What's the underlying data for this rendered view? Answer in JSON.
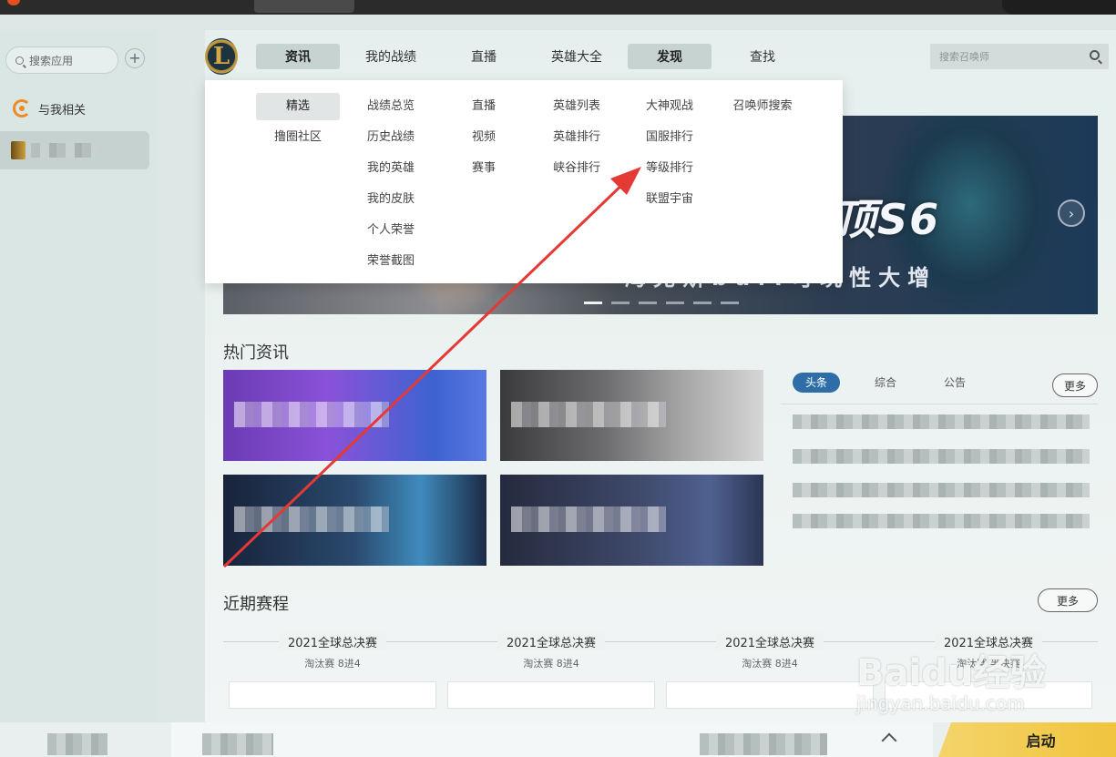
{
  "sidebar": {
    "search_placeholder": "搜索应用",
    "add_label": "+",
    "items": [
      {
        "label": "与我相关",
        "icon": "c-brand-icon"
      }
    ],
    "game_label_obscured": true
  },
  "nav": {
    "logo_letter": "L",
    "tabs": [
      "资讯",
      "我的战绩",
      "直播",
      "英雄大全",
      "发现",
      "查找"
    ],
    "active_tabs": [
      "资讯",
      "发现"
    ],
    "search_placeholder": "搜索召唤师"
  },
  "dropdown": {
    "columns": [
      [
        "精选",
        "撸圈社区"
      ],
      [
        "战绩总览",
        "历史战绩",
        "我的英雄",
        "我的皮肤",
        "个人荣誉",
        "荣誉截图"
      ],
      [
        "直播",
        "视频",
        "赛事"
      ],
      [
        "英雄列表",
        "英雄排行",
        "峡谷排行"
      ],
      [
        "大神观战",
        "国服排行",
        "等级排行",
        "联盟宇宙"
      ],
      [
        "召唤师搜索"
      ]
    ],
    "selected": "精选"
  },
  "banner": {
    "title": "开徒解密云顶S6",
    "subtitle": "海克斯buff可玩性大增",
    "slide_count": 6,
    "active_slide": 1
  },
  "hot_news": {
    "title": "热门资讯",
    "tabs": [
      "头条",
      "综合",
      "公告"
    ],
    "active_tab": "头条",
    "more": "更多"
  },
  "schedule": {
    "title": "近期赛程",
    "more": "更多",
    "matches": [
      {
        "title": "2021全球总决赛",
        "sub": "淘汰赛 8进4"
      },
      {
        "title": "2021全球总决赛",
        "sub": "淘汰赛 8进4"
      },
      {
        "title": "2021全球总决赛",
        "sub": "淘汰赛 8进4"
      },
      {
        "title": "2021全球总决赛",
        "sub": "淘汰赛 半决赛"
      }
    ]
  },
  "bottom": {
    "launch_label": "启动"
  },
  "watermark": {
    "line1": "Baidu经验",
    "line2": "jingyan.baidu.com"
  },
  "colors": {
    "accent_blue": "#2f6da9",
    "launch_yellow": "#f0c43d",
    "annotation_red": "#e53935",
    "brand_orange": "#f08a24"
  }
}
